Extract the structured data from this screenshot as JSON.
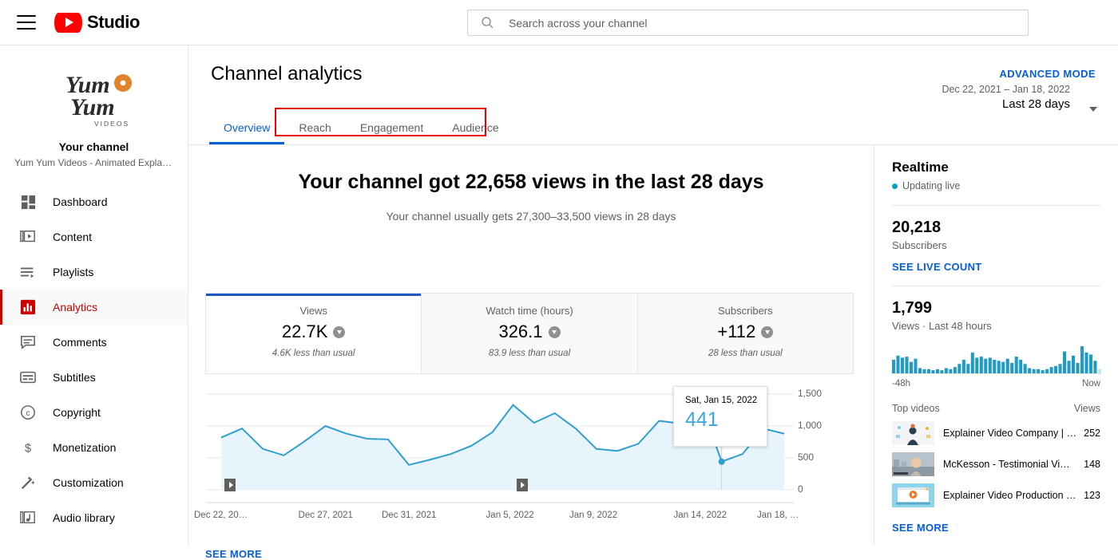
{
  "topbar": {
    "menu_icon": "hamburger-icon",
    "logo_icon": "youtube-logo-icon",
    "brand": "Studio",
    "search_icon": "search-icon",
    "search_placeholder": "Search across your channel"
  },
  "sidebar": {
    "channel_logo_alt": "Yum Yum Videos",
    "logo_line1": "Yum",
    "logo_line2": "Yum",
    "logo_line3": "VIDEOS",
    "channel_heading": "Your channel",
    "channel_desc": "Yum Yum Videos - Animated Explain…",
    "items": [
      {
        "label": "Dashboard",
        "icon": "dashboard-icon",
        "active": false
      },
      {
        "label": "Content",
        "icon": "content-icon",
        "active": false
      },
      {
        "label": "Playlists",
        "icon": "playlists-icon",
        "active": false
      },
      {
        "label": "Analytics",
        "icon": "analytics-icon",
        "active": true
      },
      {
        "label": "Comments",
        "icon": "comments-icon",
        "active": false
      },
      {
        "label": "Subtitles",
        "icon": "subtitles-icon",
        "active": false
      },
      {
        "label": "Copyright",
        "icon": "copyright-icon",
        "active": false
      },
      {
        "label": "Monetization",
        "icon": "dollar-icon",
        "active": false
      },
      {
        "label": "Customization",
        "icon": "magic-wand-icon",
        "active": false
      },
      {
        "label": "Audio library",
        "icon": "audio-library-icon",
        "active": false
      }
    ]
  },
  "header": {
    "title": "Channel analytics",
    "advanced_mode": "ADVANCED MODE",
    "date_range": "Dec 22, 2021 – Jan 18, 2022",
    "date_label": "Last 28 days",
    "caret_icon": "chevron-down-icon",
    "tabs": [
      {
        "label": "Overview",
        "active": true
      },
      {
        "label": "Reach",
        "active": false
      },
      {
        "label": "Engagement",
        "active": false
      },
      {
        "label": "Audience",
        "active": false
      }
    ],
    "annotation_color": "#ee0000"
  },
  "overview": {
    "headline": "Your channel got 22,658 views in the last 28 days",
    "subheadline": "Your channel usually gets 27,300–33,500 views in 28 days",
    "cards": [
      {
        "label": "Views",
        "value": "22.7K",
        "note": "4.6K less than usual",
        "trend": "down",
        "selected": true
      },
      {
        "label": "Watch time (hours)",
        "value": "326.1",
        "note": "83.9 less than usual",
        "trend": "down",
        "selected": false
      },
      {
        "label": "Subscribers",
        "value": "+112",
        "note": "28 less than usual",
        "trend": "down",
        "selected": false
      }
    ],
    "see_more": "SEE MORE"
  },
  "chart_data": {
    "type": "area",
    "title": "Views over time",
    "xlabel": "",
    "ylabel": "Views",
    "ylim": [
      0,
      1500
    ],
    "yticks": [
      0,
      500,
      1000,
      1500
    ],
    "ytick_labels": [
      "0",
      "500",
      "1,000",
      "1,500"
    ],
    "grid": true,
    "line_color": "#2f9fd0",
    "fill_color": "#e8f4fb",
    "xtick_labels": [
      "Dec 22, 20…",
      "Dec 27, 2021",
      "Dec 31, 2021",
      "Jan 5, 2022",
      "Jan 9, 2022",
      "Jan 14, 2022",
      "Jan 18, …"
    ],
    "x": [
      "Dec 22, 2021",
      "Dec 23, 2021",
      "Dec 24, 2021",
      "Dec 25, 2021",
      "Dec 26, 2021",
      "Dec 27, 2021",
      "Dec 28, 2021",
      "Dec 29, 2021",
      "Dec 30, 2021",
      "Dec 31, 2021",
      "Jan 1, 2022",
      "Jan 2, 2022",
      "Jan 3, 2022",
      "Jan 4, 2022",
      "Jan 5, 2022",
      "Jan 6, 2022",
      "Jan 7, 2022",
      "Jan 8, 2022",
      "Jan 9, 2022",
      "Jan 10, 2022",
      "Jan 11, 2022",
      "Jan 12, 2022",
      "Jan 13, 2022",
      "Jan 14, 2022",
      "Jan 15, 2022",
      "Jan 16, 2022",
      "Jan 17, 2022",
      "Jan 18, 2022"
    ],
    "values": [
      820,
      960,
      640,
      540,
      760,
      1000,
      880,
      800,
      790,
      390,
      470,
      560,
      690,
      900,
      1330,
      1050,
      1200,
      960,
      640,
      610,
      720,
      1080,
      1040,
      1360,
      441,
      560,
      960,
      880
    ],
    "annotations": [
      {
        "type": "tooltip",
        "x": "Jan 15, 2022",
        "label": "Sat, Jan 15, 2022",
        "value": "441"
      },
      {
        "type": "video-marker",
        "x": "Dec 22, 2021"
      },
      {
        "type": "video-marker",
        "x": "Jan 5, 2022"
      }
    ]
  },
  "realtime": {
    "title": "Realtime",
    "live_status": "Updating live",
    "subscribers_count": "20,218",
    "subscribers_label": "Subscribers",
    "live_count_link": "SEE LIVE COUNT",
    "views_count": "1,799",
    "views_label": "Views · Last 48 hours",
    "spark_start": "-48h",
    "spark_end": "Now",
    "spark_color": "#1f9bc6",
    "spark_values": [
      13,
      17,
      15,
      16,
      11,
      14,
      5,
      4,
      4,
      3,
      4,
      3,
      5,
      4,
      6,
      9,
      13,
      9,
      20,
      15,
      16,
      14,
      15,
      13,
      12,
      11,
      14,
      10,
      16,
      13,
      9,
      5,
      4,
      4,
      3,
      4,
      6,
      7,
      9,
      21,
      12,
      17,
      10,
      26,
      20,
      18,
      12,
      4
    ],
    "top_videos_header": "Top videos",
    "views_header": "Views",
    "videos": [
      {
        "title": "Explainer Video Company | …",
        "views": "252",
        "thumb": "thumb-person-orange"
      },
      {
        "title": "McKesson - Testimonial Vi…",
        "views": "148",
        "thumb": "thumb-woman-outdoor"
      },
      {
        "title": "Explainer Video Production …",
        "views": "123",
        "thumb": "thumb-play-screen"
      }
    ],
    "see_more": "SEE MORE"
  }
}
